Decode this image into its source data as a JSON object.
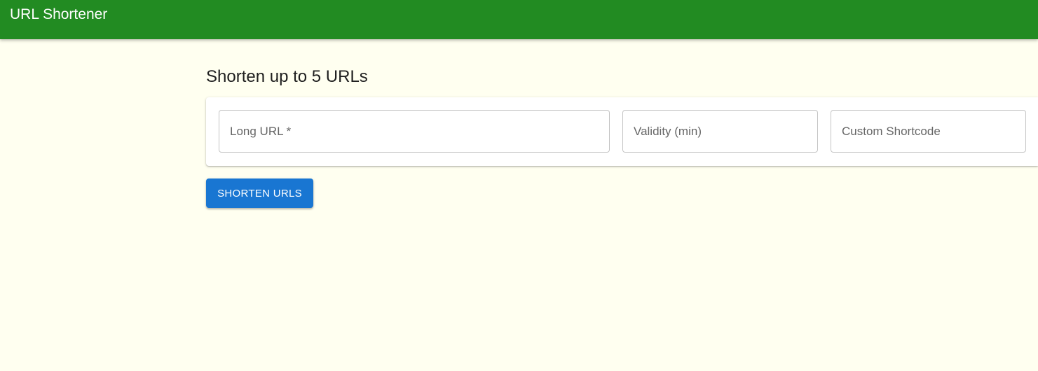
{
  "appbar": {
    "title": "URL Shortener",
    "background_color": "#228b22"
  },
  "main": {
    "heading": "Shorten up to 5 URLs",
    "form": {
      "long_url": {
        "value": "",
        "placeholder": "Long URL *"
      },
      "validity": {
        "value": "",
        "placeholder": "Validity (min)"
      },
      "shortcode": {
        "value": "",
        "placeholder": "Custom Shortcode"
      }
    },
    "submit_label": "SHORTEN URLS",
    "submit_color": "#1976d2"
  },
  "page_background": "#fffff0"
}
